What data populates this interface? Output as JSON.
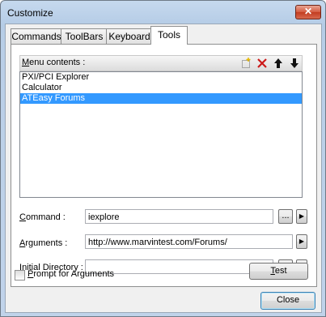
{
  "window": {
    "title": "Customize",
    "close_glyph": "✕"
  },
  "tabs": [
    {
      "label": "Commands",
      "active": false
    },
    {
      "label": "ToolBars",
      "active": false
    },
    {
      "label": "Keyboard",
      "active": false
    },
    {
      "label": "Tools",
      "active": true
    }
  ],
  "menu_contents": {
    "label_mnemonic": "M",
    "label_rest": "enu contents :",
    "toolbar_icons": [
      "new-item-icon",
      "delete-icon",
      "move-up-icon",
      "move-down-icon"
    ],
    "items": [
      {
        "label": "PXI/PCI Explorer",
        "selected": false
      },
      {
        "label": "Calculator",
        "selected": false
      },
      {
        "label": "ATEasy Forums",
        "selected": true
      }
    ]
  },
  "fields": {
    "command": {
      "label_mnemonic": "C",
      "label_rest": "ommand :",
      "value": "iexplore"
    },
    "arguments": {
      "label_mnemonic": "A",
      "label_rest": "rguments :",
      "value": "http://www.marvintest.com/Forums/"
    },
    "initial_directory": {
      "label_mnemonic": "I",
      "label_rest": "nitial Directory :",
      "value": ""
    }
  },
  "browse_label": "...",
  "arrow_glyph": "▶",
  "prompt_checkbox": {
    "label_mnemonic": "P",
    "label_rest": "rompt for Arguments",
    "checked": false
  },
  "test_button": {
    "label_mnemonic": "T",
    "label_rest": "est"
  },
  "close_button": {
    "label": "Close"
  },
  "colors": {
    "selection": "#3399ff",
    "title_bar": "#b9d1ea",
    "close_red": "#c7432a"
  }
}
